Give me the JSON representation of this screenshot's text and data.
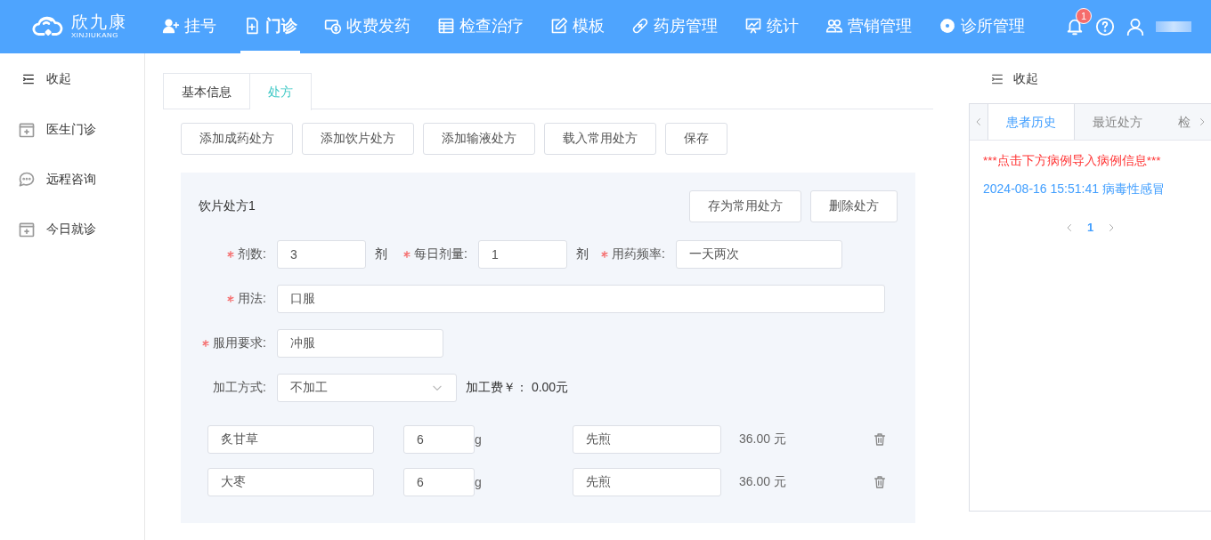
{
  "logo": {
    "name": "欣九康",
    "subtitle": "XINJIUKANG"
  },
  "nav": [
    {
      "label": "挂号",
      "selected": false
    },
    {
      "label": "门诊",
      "selected": true
    },
    {
      "label": "收费发药",
      "selected": false
    },
    {
      "label": "检查治疗",
      "selected": false
    },
    {
      "label": "模板",
      "selected": false
    },
    {
      "label": "药房管理",
      "selected": false
    },
    {
      "label": "统计",
      "selected": false
    },
    {
      "label": "营销管理",
      "selected": false
    },
    {
      "label": "诊所管理",
      "selected": false
    }
  ],
  "header": {
    "notifications": "1"
  },
  "sidebar": {
    "collapse": "收起",
    "items": [
      {
        "label": "医生门诊"
      },
      {
        "label": "远程咨询"
      },
      {
        "label": "今日就诊"
      }
    ]
  },
  "tabs": [
    {
      "label": "基本信息",
      "selected": false
    },
    {
      "label": "处方",
      "selected": true
    }
  ],
  "actions": [
    "添加成药处方",
    "添加饮片处方",
    "添加输液处方",
    "载入常用处方",
    "保存"
  ],
  "prescription": {
    "title": "饮片处方1",
    "buttons": [
      "存为常用处方",
      "删除处方"
    ],
    "dose": {
      "label": "剂数:",
      "required": true,
      "value": "3",
      "unit": "剂"
    },
    "daily": {
      "label": "每日剂量:",
      "required": true,
      "value": "1",
      "unit": "剂"
    },
    "frequency": {
      "label": "用药频率:",
      "required": true,
      "value": "一天两次"
    },
    "usage": {
      "label": "用法:",
      "required": true,
      "value": "口服"
    },
    "requirement": {
      "label": "服用要求:",
      "required": true,
      "value": "冲服"
    },
    "processing": {
      "label": "加工方式:",
      "required": false,
      "value": "不加工",
      "fee": "加工费￥： 0.00元"
    },
    "herbs": [
      {
        "name": "炙甘草",
        "amount": "6",
        "unit": "g",
        "method": "先煎",
        "price": "36.00 元"
      },
      {
        "name": "大枣",
        "amount": "6",
        "unit": "g",
        "method": "先煎",
        "price": "36.00 元"
      }
    ]
  },
  "history": {
    "collapse": "收起",
    "tabs": [
      {
        "label": "患者历史",
        "selected": true
      },
      {
        "label": "最近处方",
        "selected": false
      },
      {
        "label": "检",
        "selected": false
      }
    ],
    "notice": "***点击下方病例导入病例信息***",
    "records": [
      "2024-08-16 15:51:41 病毒性感冒"
    ],
    "pages": [
      {
        "label": "1",
        "selected": true
      }
    ]
  }
}
